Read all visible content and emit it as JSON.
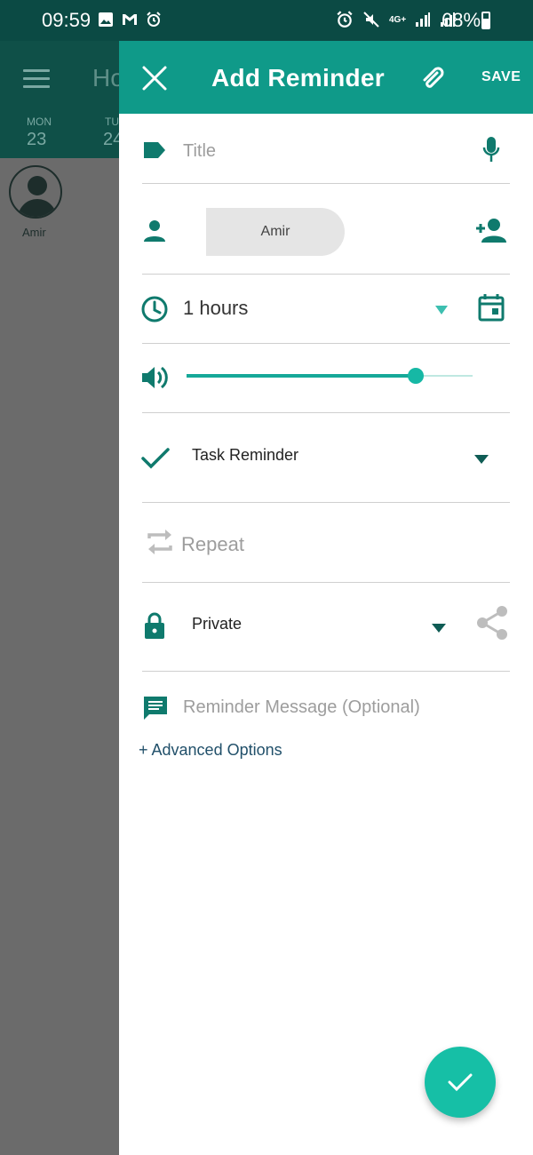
{
  "status_bar": {
    "time": "09:59",
    "battery": "68%",
    "network": "4G+"
  },
  "background_app": {
    "title_partial": "Ho",
    "days": [
      {
        "day": "MON",
        "date": "23"
      },
      {
        "day": "TU",
        "date": "24"
      }
    ],
    "contact_name": "Amir"
  },
  "header": {
    "title": "Add Reminder",
    "save_label": "SAVE",
    "accent_color": "#0f9a89"
  },
  "form": {
    "title_placeholder": "Title",
    "assignee": "Amir",
    "time_value": "1 hours",
    "volume_level": 0.8,
    "reminder_type": "Task Reminder",
    "repeat_label": "Repeat",
    "privacy": "Private",
    "message_placeholder": "Reminder Message (Optional)",
    "advanced_options": "+ Advanced Options"
  },
  "icons": [
    "close-icon",
    "attach-icon",
    "label-icon",
    "mic-icon",
    "person-icon",
    "add-person-icon",
    "clock-icon",
    "calendar-icon",
    "volume-icon",
    "check-icon",
    "repeat-icon",
    "lock-icon",
    "share-icon",
    "message-icon",
    "confirm-icon"
  ]
}
